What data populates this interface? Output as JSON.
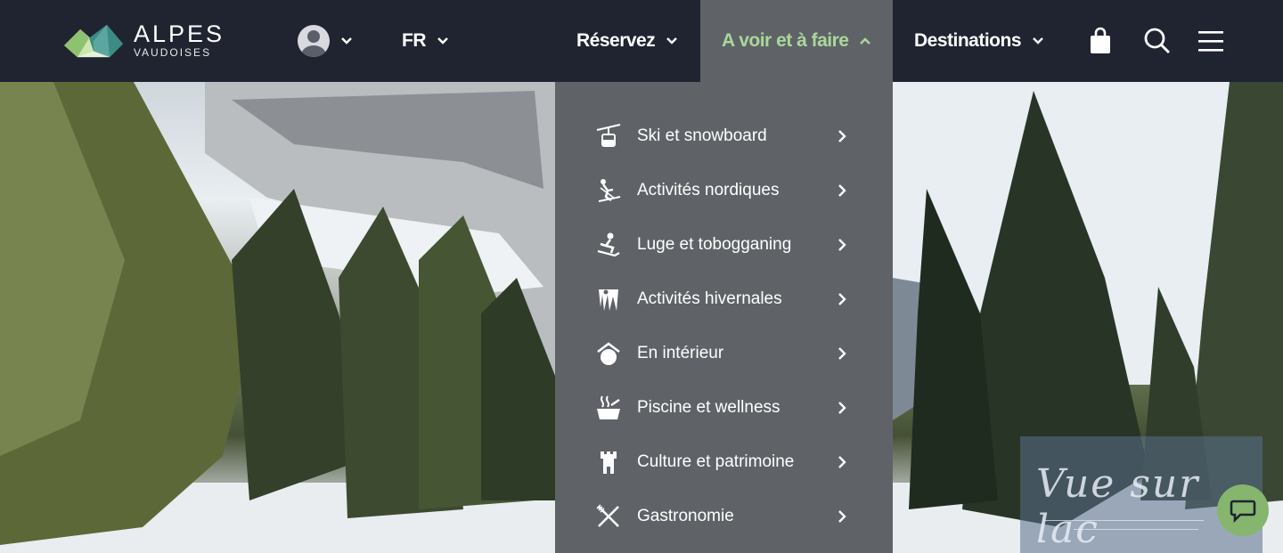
{
  "brand": {
    "name": "ALPES",
    "subtitle": "VAUDOISES"
  },
  "header": {
    "language": "FR",
    "nav": [
      {
        "label": "Réservez",
        "expanded": false
      },
      {
        "label": "A voir et à faire",
        "expanded": true
      },
      {
        "label": "Destinations",
        "expanded": false
      }
    ],
    "icons": [
      "user-avatar-icon",
      "shopping-bag-icon",
      "search-icon",
      "hamburger-menu-icon"
    ]
  },
  "dropdown": {
    "items": [
      {
        "label": "Ski et snowboard",
        "icon": "cable-car-icon"
      },
      {
        "label": "Activités nordiques",
        "icon": "nordic-ski-icon"
      },
      {
        "label": "Luge et tobogganing",
        "icon": "sled-icon"
      },
      {
        "label": "Activités hivernales",
        "icon": "ice-climbing-icon"
      },
      {
        "label": "En intérieur",
        "icon": "indoor-house-icon"
      },
      {
        "label": "Piscine et wellness",
        "icon": "hot-tub-icon"
      },
      {
        "label": "Culture et patrimoine",
        "icon": "castle-tower-icon"
      },
      {
        "label": "Gastronomie",
        "icon": "fork-knife-icon"
      }
    ]
  },
  "hero": {
    "badge_text": "Vue sur lac"
  },
  "colors": {
    "header_bg": "#1f2430",
    "dropdown_bg": "#5f6368",
    "accent_green": "#a9d79a",
    "chat_green": "#86b56e"
  }
}
